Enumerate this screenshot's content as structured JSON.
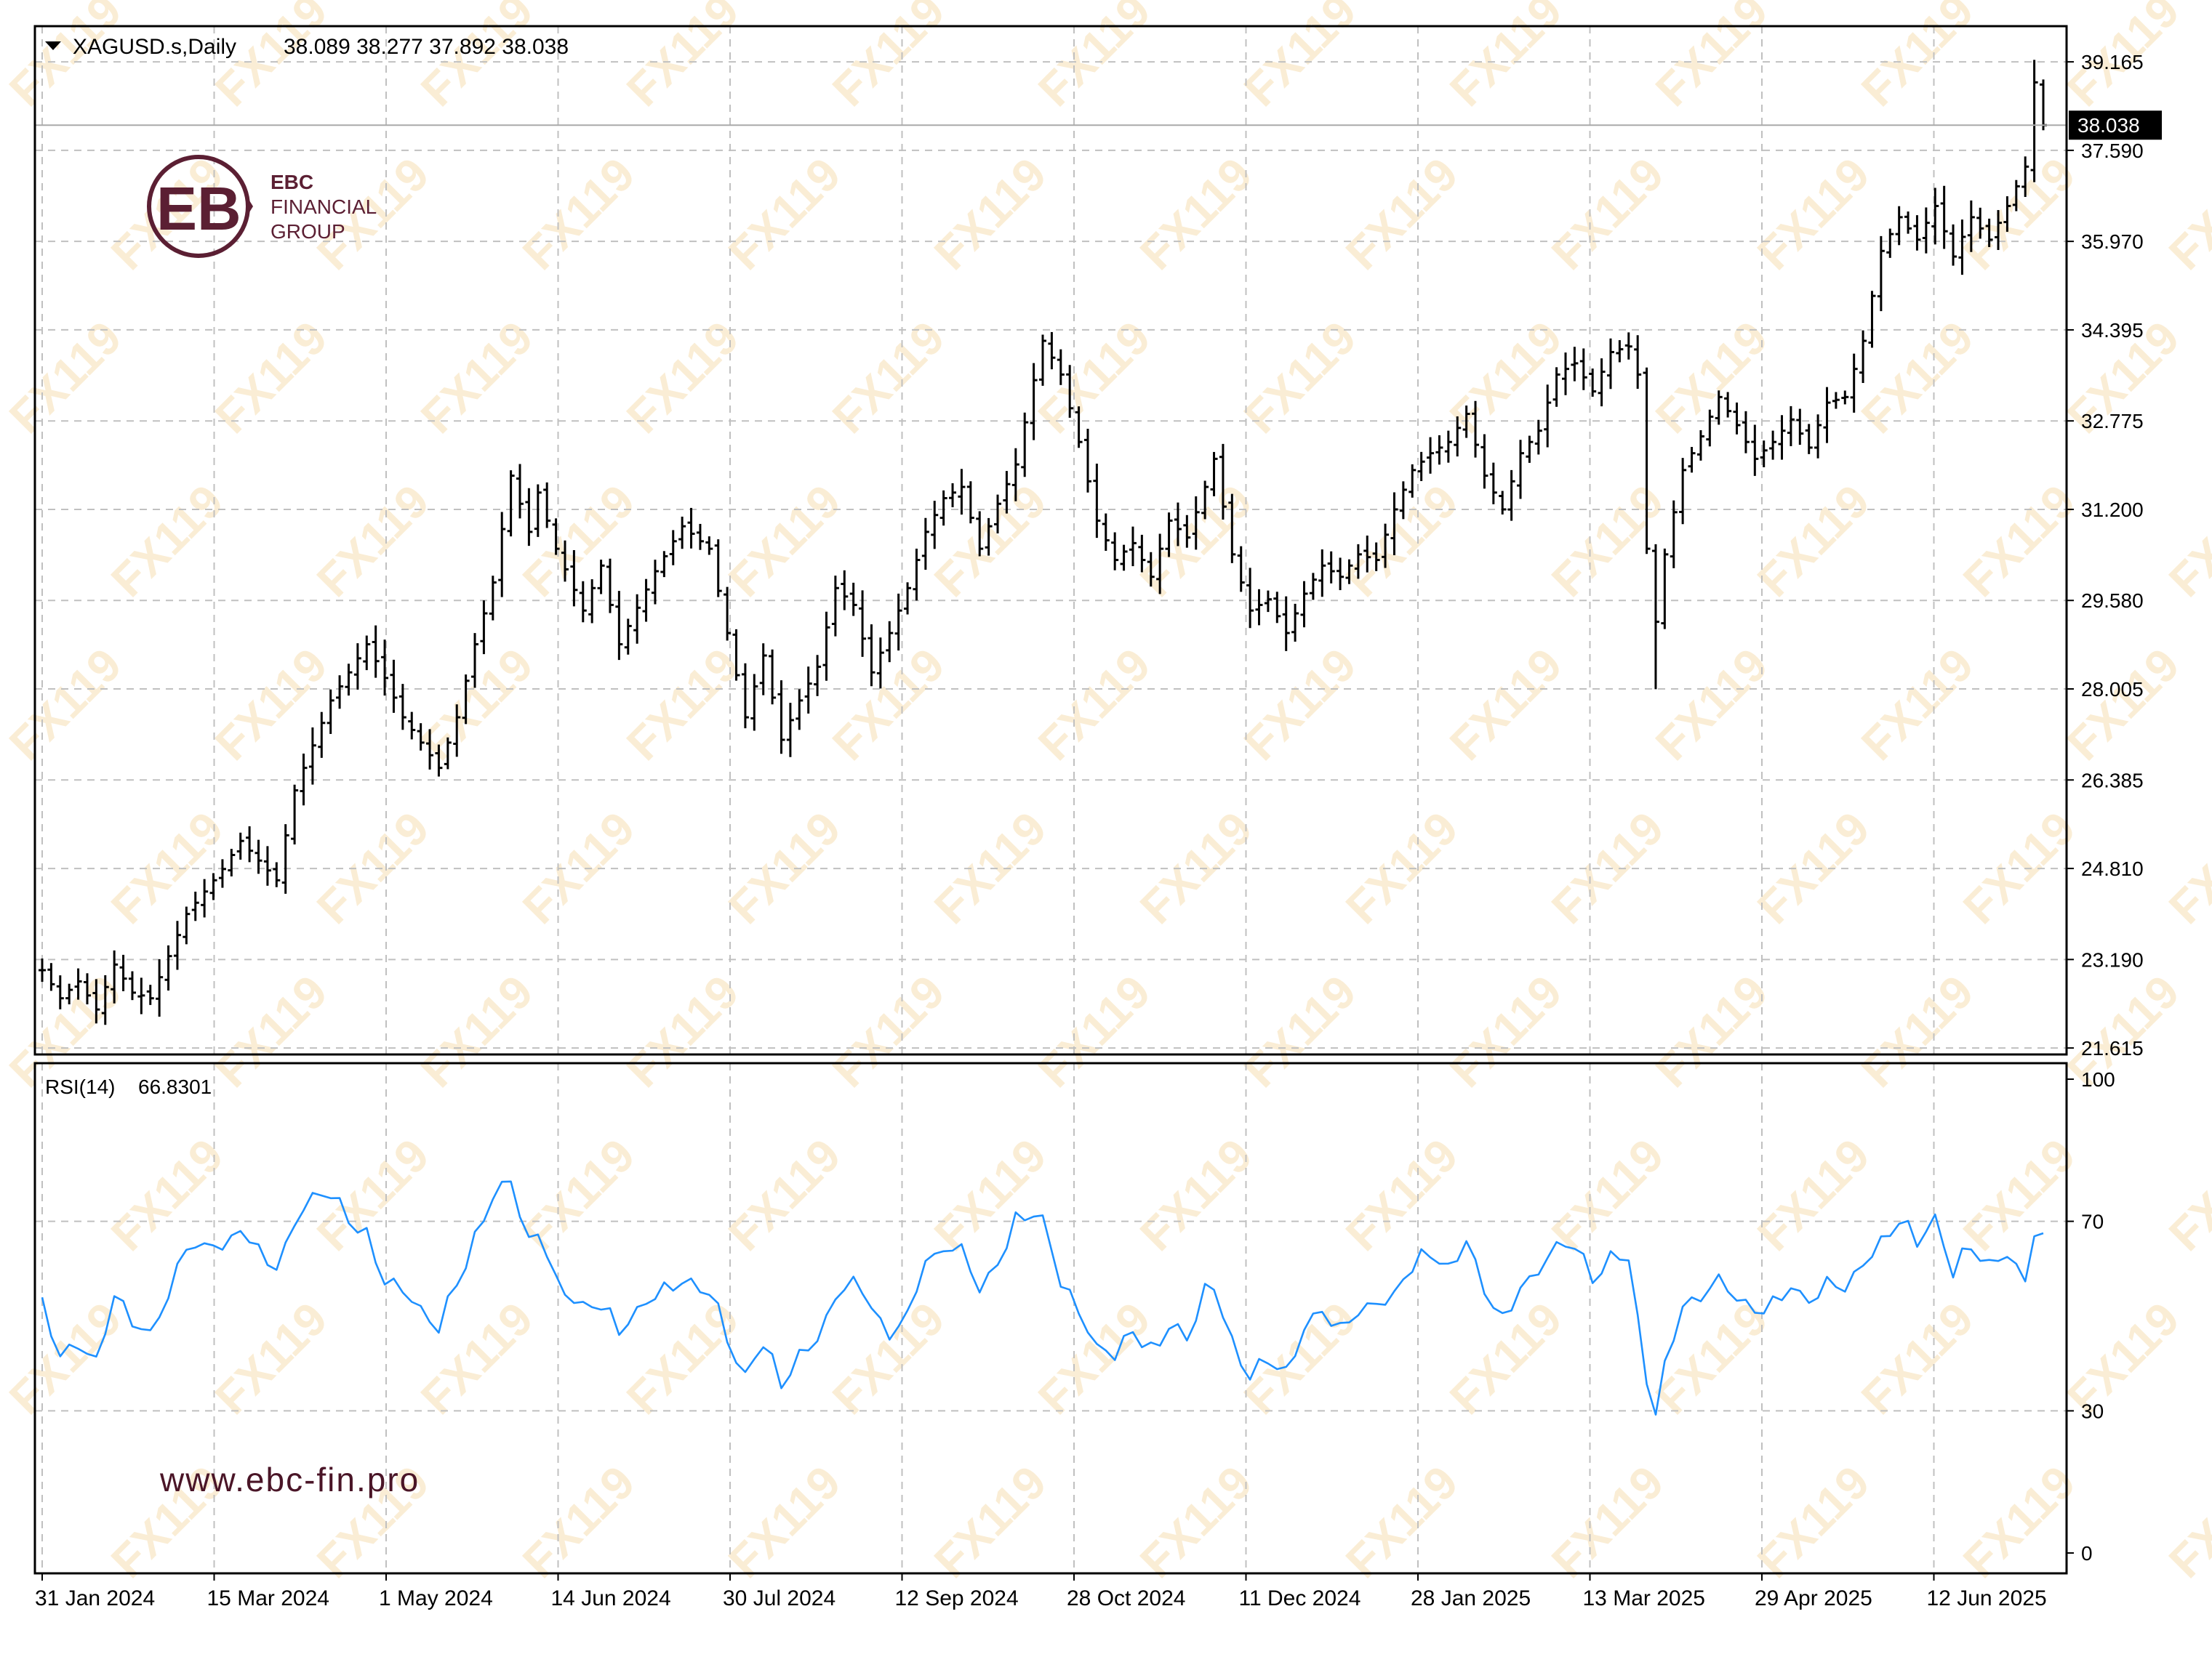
{
  "header": {
    "dropdown_icon": "triangle-down-icon",
    "symbol": "XAGUSD.s,Daily",
    "ohlc": "38.089 38.277 37.892 38.038"
  },
  "logo": {
    "line1": "EBC",
    "line2": "FINANCIAL",
    "line3": "GROUP",
    "color": "#5b1f33"
  },
  "website": "www.ebc-fin.pro",
  "watermark": "FX119",
  "colors": {
    "bars": "#000000",
    "rsi_line": "#1e90ff",
    "grid": "#c0c0c0",
    "last_price_bg": "#000000",
    "last_price_text": "#ffffff",
    "watermark": "#f5deb3"
  },
  "chart_data": [
    {
      "type": "ohlc",
      "title": "XAGUSD.s,Daily",
      "last_price": "38.038",
      "price_ticks": [
        "39.165",
        "37.590",
        "35.970",
        "34.395",
        "32.775",
        "31.200",
        "29.580",
        "28.005",
        "26.385",
        "24.810",
        "23.190",
        "21.615"
      ],
      "ylim": [
        21.5,
        39.8
      ],
      "date_ticks": [
        "31 Jan 2024",
        "15 Mar 2024",
        "1 May 2024",
        "14 Jun 2024",
        "30 Jul 2024",
        "12 Sep 2024",
        "28 Oct 2024",
        "11 Dec 2024",
        "28 Jan 2025",
        "13 Mar 2025",
        "29 Apr 2025",
        "12 Jun 2025"
      ],
      "grid": true,
      "approx_close_path": [
        [
          0,
          23.0
        ],
        [
          2,
          22.5
        ],
        [
          4,
          22.8
        ],
        [
          6,
          22.3
        ],
        [
          8,
          23.1
        ],
        [
          10,
          22.6
        ],
        [
          12,
          22.5
        ],
        [
          16,
          24.0
        ],
        [
          20,
          24.8
        ],
        [
          22,
          25.3
        ],
        [
          26,
          24.6
        ],
        [
          28,
          26.2
        ],
        [
          32,
          27.8
        ],
        [
          36,
          28.8
        ],
        [
          38,
          28.2
        ],
        [
          40,
          27.5
        ],
        [
          44,
          26.6
        ],
        [
          46,
          27.5
        ],
        [
          48,
          28.8
        ],
        [
          50,
          29.9
        ],
        [
          52,
          31.8
        ],
        [
          54,
          30.8
        ],
        [
          55,
          31.5
        ],
        [
          57,
          30.5
        ],
        [
          60,
          29.4
        ],
        [
          62,
          30.2
        ],
        [
          64,
          28.8
        ],
        [
          68,
          30.1
        ],
        [
          71,
          30.9
        ],
        [
          74,
          30.5
        ],
        [
          76,
          29.0
        ],
        [
          78,
          27.5
        ],
        [
          80,
          28.6
        ],
        [
          82,
          27.1
        ],
        [
          84,
          27.8
        ],
        [
          86,
          28.4
        ],
        [
          88,
          29.8
        ],
        [
          90,
          29.5
        ],
        [
          92,
          28.3
        ],
        [
          94,
          29.0
        ],
        [
          96,
          29.8
        ],
        [
          98,
          30.8
        ],
        [
          100,
          31.4
        ],
        [
          102,
          31.6
        ],
        [
          104,
          30.5
        ],
        [
          106,
          31.3
        ],
        [
          108,
          32.0
        ],
        [
          110,
          33.5
        ],
        [
          111,
          34.2
        ],
        [
          113,
          33.6
        ],
        [
          115,
          32.4
        ],
        [
          117,
          31.0
        ],
        [
          119,
          30.3
        ],
        [
          121,
          30.6
        ],
        [
          123,
          30.0
        ],
        [
          125,
          31.0
        ],
        [
          127,
          30.7
        ],
        [
          129,
          31.6
        ],
        [
          130,
          32.1
        ],
        [
          132,
          30.4
        ],
        [
          134,
          29.4
        ],
        [
          136,
          29.6
        ],
        [
          138,
          29.0
        ],
        [
          140,
          29.7
        ],
        [
          142,
          30.2
        ],
        [
          144,
          30.0
        ],
        [
          146,
          30.4
        ],
        [
          148,
          30.3
        ],
        [
          150,
          31.2
        ],
        [
          152,
          31.9
        ],
        [
          154,
          32.2
        ],
        [
          156,
          32.4
        ],
        [
          158,
          32.9
        ],
        [
          160,
          31.8
        ],
        [
          162,
          31.2
        ],
        [
          164,
          32.2
        ],
        [
          166,
          32.6
        ],
        [
          168,
          33.6
        ],
        [
          170,
          33.8
        ],
        [
          172,
          33.3
        ],
        [
          174,
          34.0
        ],
        [
          176,
          34.1
        ],
        [
          177,
          33.6
        ],
        [
          178,
          30.5
        ],
        [
          179,
          29.2
        ],
        [
          180,
          30.4
        ],
        [
          182,
          31.9
        ],
        [
          184,
          32.5
        ],
        [
          186,
          33.2
        ],
        [
          188,
          32.7
        ],
        [
          190,
          32.1
        ],
        [
          192,
          32.4
        ],
        [
          194,
          32.8
        ],
        [
          196,
          32.3
        ],
        [
          198,
          33.1
        ],
        [
          200,
          33.2
        ],
        [
          202,
          34.2
        ],
        [
          204,
          35.8
        ],
        [
          206,
          36.4
        ],
        [
          208,
          36.0
        ],
        [
          210,
          36.6
        ],
        [
          212,
          35.7
        ],
        [
          214,
          36.4
        ],
        [
          216,
          36.0
        ],
        [
          218,
          36.6
        ],
        [
          220,
          37.3
        ],
        [
          221,
          38.8
        ],
        [
          222,
          38.038
        ]
      ]
    },
    {
      "type": "line",
      "title": "RSI(14)",
      "value_label": "66.8301",
      "ticks": [
        "100",
        "70",
        "30",
        "0"
      ],
      "ylim": [
        0,
        100
      ],
      "levels": [
        30,
        70
      ],
      "approx_path": [
        [
          0,
          52
        ],
        [
          2,
          42
        ],
        [
          4,
          45
        ],
        [
          6,
          40
        ],
        [
          8,
          55
        ],
        [
          10,
          48
        ],
        [
          12,
          47
        ],
        [
          16,
          64
        ],
        [
          20,
          66
        ],
        [
          22,
          68
        ],
        [
          26,
          60
        ],
        [
          28,
          70
        ],
        [
          30,
          75
        ],
        [
          32,
          76
        ],
        [
          34,
          71
        ],
        [
          36,
          68
        ],
        [
          38,
          58
        ],
        [
          40,
          55
        ],
        [
          44,
          48
        ],
        [
          46,
          58
        ],
        [
          48,
          66
        ],
        [
          50,
          75
        ],
        [
          52,
          79
        ],
        [
          54,
          66
        ],
        [
          55,
          68
        ],
        [
          57,
          58
        ],
        [
          60,
          53
        ],
        [
          62,
          52
        ],
        [
          64,
          48
        ],
        [
          68,
          55
        ],
        [
          71,
          58
        ],
        [
          74,
          56
        ],
        [
          76,
          46
        ],
        [
          78,
          37
        ],
        [
          80,
          45
        ],
        [
          82,
          35
        ],
        [
          84,
          42
        ],
        [
          86,
          45
        ],
        [
          88,
          54
        ],
        [
          90,
          58
        ],
        [
          92,
          52
        ],
        [
          94,
          46
        ],
        [
          96,
          51
        ],
        [
          98,
          62
        ],
        [
          100,
          64
        ],
        [
          102,
          64
        ],
        [
          104,
          56
        ],
        [
          106,
          62
        ],
        [
          108,
          70
        ],
        [
          110,
          72
        ],
        [
          111,
          70
        ],
        [
          113,
          58
        ],
        [
          115,
          51
        ],
        [
          117,
          44
        ],
        [
          119,
          42
        ],
        [
          121,
          47
        ],
        [
          123,
          43
        ],
        [
          125,
          48
        ],
        [
          127,
          46
        ],
        [
          129,
          55
        ],
        [
          130,
          57
        ],
        [
          132,
          44
        ],
        [
          134,
          38
        ],
        [
          136,
          40
        ],
        [
          138,
          38
        ],
        [
          140,
          49
        ],
        [
          142,
          51
        ],
        [
          144,
          48
        ],
        [
          146,
          52
        ],
        [
          148,
          53
        ],
        [
          150,
          55
        ],
        [
          152,
          61
        ],
        [
          154,
          64
        ],
        [
          156,
          60
        ],
        [
          158,
          66
        ],
        [
          160,
          55
        ],
        [
          162,
          49
        ],
        [
          164,
          56
        ],
        [
          166,
          60
        ],
        [
          168,
          65
        ],
        [
          170,
          66
        ],
        [
          172,
          58
        ],
        [
          174,
          63
        ],
        [
          176,
          62
        ],
        [
          177,
          50
        ],
        [
          178,
          36
        ],
        [
          179,
          30
        ],
        [
          180,
          40
        ],
        [
          182,
          52
        ],
        [
          184,
          55
        ],
        [
          186,
          58
        ],
        [
          188,
          55
        ],
        [
          190,
          51
        ],
        [
          192,
          54
        ],
        [
          194,
          56
        ],
        [
          196,
          53
        ],
        [
          198,
          57
        ],
        [
          200,
          57
        ],
        [
          202,
          61
        ],
        [
          204,
          66
        ],
        [
          206,
          71
        ],
        [
          208,
          66
        ],
        [
          210,
          70
        ],
        [
          212,
          60
        ],
        [
          214,
          66
        ],
        [
          216,
          60
        ],
        [
          218,
          64
        ],
        [
          220,
          58
        ],
        [
          221,
          68
        ],
        [
          222,
          66.8
        ]
      ]
    }
  ]
}
